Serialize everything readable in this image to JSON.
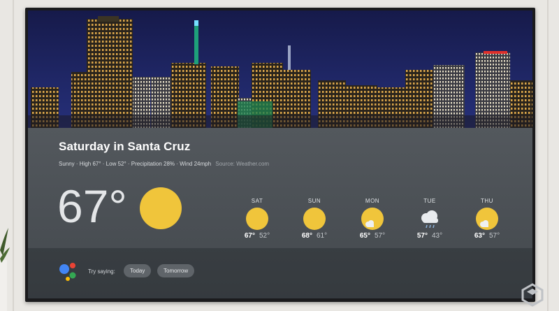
{
  "weather": {
    "title": "Saturday in Santa Cruz",
    "summary": "Sunny · High 67° · Low 52° · Precipitation 28% · Wind 24mph",
    "source": "Source: Weather.com",
    "current_temp": "67°",
    "current_icon": "sun-icon",
    "forecast": [
      {
        "day": "SAT",
        "icon": "sun-icon",
        "high": "67°",
        "low": "52°"
      },
      {
        "day": "SUN",
        "icon": "sun-icon",
        "high": "68°",
        "low": "61°"
      },
      {
        "day": "MON",
        "icon": "partly-cloudy-icon",
        "high": "65°",
        "low": "57°"
      },
      {
        "day": "TUE",
        "icon": "rain-cloud-icon",
        "high": "57°",
        "low": "43°"
      },
      {
        "day": "THU",
        "icon": "partly-cloudy-icon",
        "high": "63°",
        "low": "57°"
      }
    ]
  },
  "assistant": {
    "try_label": "Try saying:",
    "suggestions": [
      "Today",
      "Tomorrow"
    ],
    "colors": [
      "#4285f4",
      "#ea4335",
      "#fbbc05",
      "#34a853"
    ]
  },
  "colors": {
    "sun": "#f0c53b",
    "panel": "#4b5055"
  }
}
